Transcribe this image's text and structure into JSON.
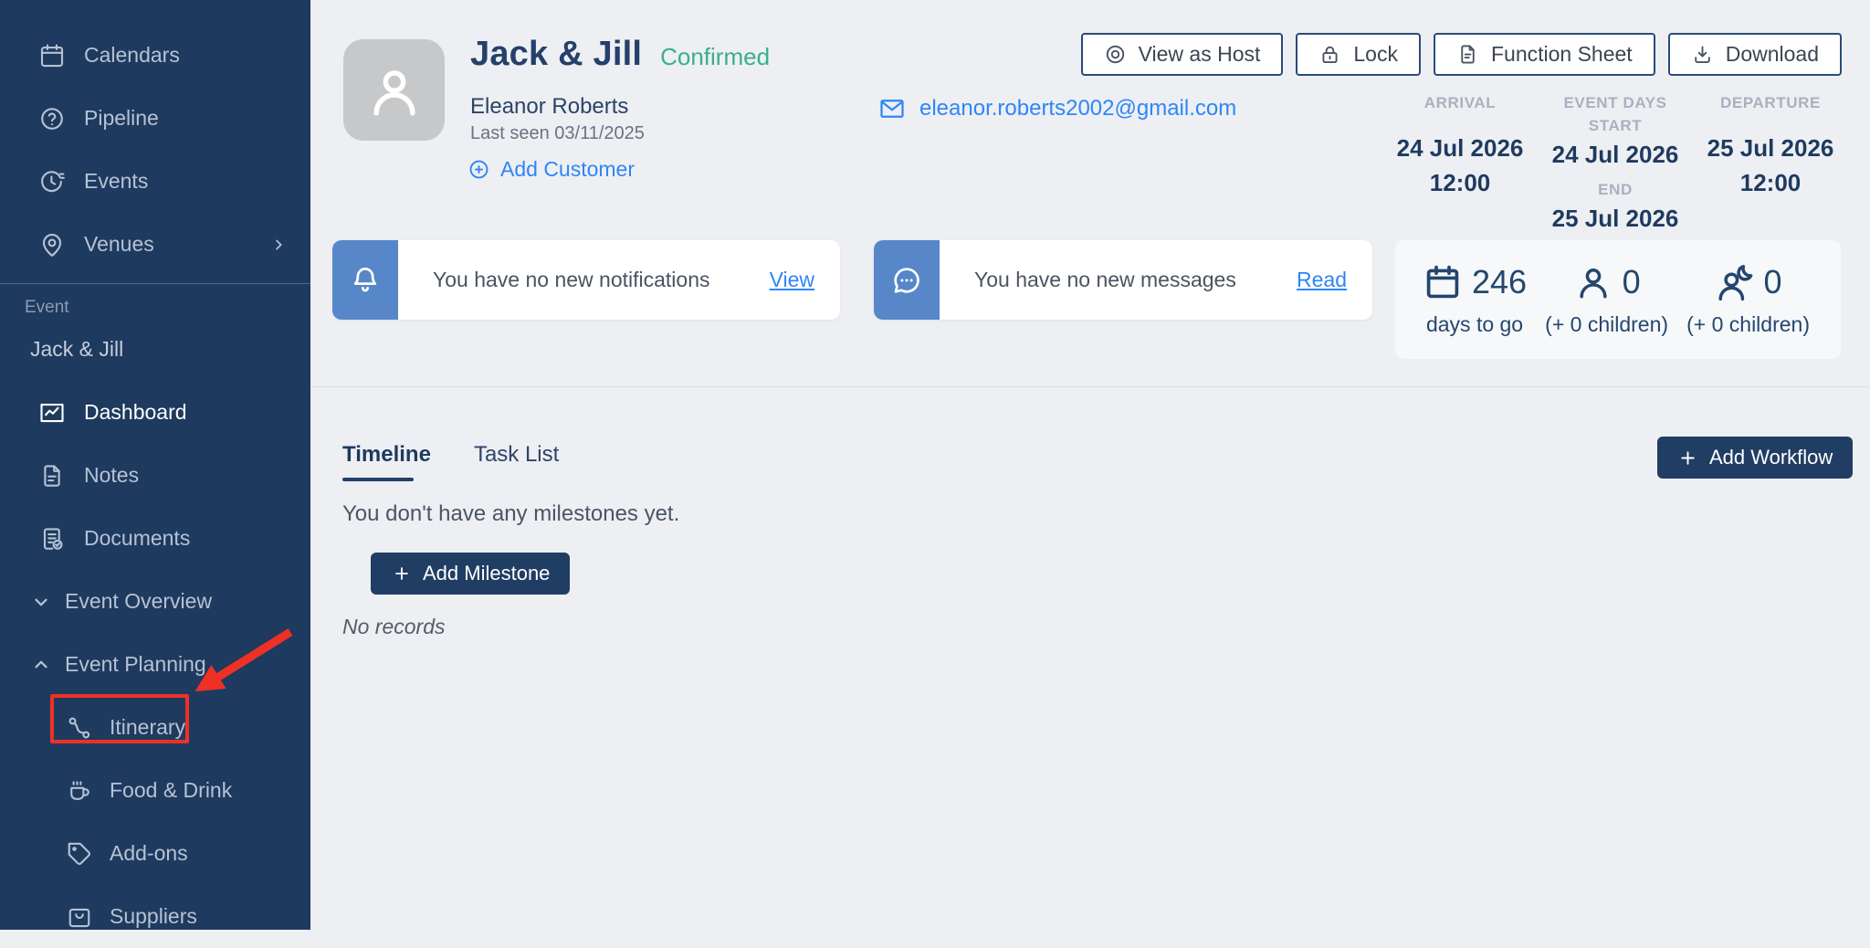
{
  "sidebar": {
    "section_label": "Event",
    "event_name": "Jack & Jill",
    "items": [
      {
        "label": "Calendars",
        "icon": "calendar-icon"
      },
      {
        "label": "Pipeline",
        "icon": "help-circle-icon"
      },
      {
        "label": "Events",
        "icon": "clock-icon"
      },
      {
        "label": "Venues",
        "icon": "map-pin-icon",
        "chevron": "right"
      },
      {
        "label": "Dashboard",
        "icon": "chart-icon",
        "active": true
      },
      {
        "label": "Notes",
        "icon": "note-icon"
      },
      {
        "label": "Documents",
        "icon": "document-check-icon"
      },
      {
        "label": "Event Overview",
        "icon": "chevron-down-icon",
        "expanded": false
      },
      {
        "label": "Event Planning",
        "icon": "chevron-up-icon",
        "expanded": true
      },
      {
        "label": "Itinerary",
        "icon": "route-icon",
        "annotated": true
      },
      {
        "label": "Food & Drink",
        "icon": "coffee-icon"
      },
      {
        "label": "Add-ons",
        "icon": "tag-icon"
      },
      {
        "label": "Suppliers",
        "icon": "case-icon"
      }
    ]
  },
  "header": {
    "title": "Jack & Jill",
    "status": "Confirmed",
    "customer_name": "Eleanor Roberts",
    "last_seen": "Last seen 03/11/2025",
    "add_customer_label": "Add Customer",
    "email": "eleanor.roberts2002@gmail.com",
    "actions": [
      {
        "label": "View as Host",
        "icon": "view-icon"
      },
      {
        "label": "Lock",
        "icon": "lock-icon"
      },
      {
        "label": "Function Sheet",
        "icon": "file-icon"
      },
      {
        "label": "Download",
        "icon": "download-icon"
      }
    ],
    "dates": {
      "arrival_label": "ARRIVAL",
      "arrival_date": "24 Jul 2026",
      "arrival_time": "12:00",
      "event_days_label": "EVENT DAYS",
      "start_label": "START",
      "start_date": "24 Jul 2026",
      "end_label": "END",
      "end_date": "25 Jul 2026",
      "departure_label": "DEPARTURE",
      "departure_date": "25 Jul 2026",
      "departure_time": "12:00"
    }
  },
  "cards": {
    "notifications": {
      "text": "You have no new notifications",
      "action": "View"
    },
    "messages": {
      "text": "You have no new messages",
      "action": "Read"
    },
    "stats": [
      {
        "value": "246",
        "label": "days to go",
        "icon": "calendar-icon"
      },
      {
        "value": "0",
        "label": "(+ 0 children)",
        "icon": "person-icon"
      },
      {
        "value": "0",
        "label": "(+ 0 children)",
        "icon": "person-moon-icon"
      }
    ]
  },
  "content": {
    "tabs": [
      {
        "label": "Timeline",
        "active": true
      },
      {
        "label": "Task List",
        "active": false
      }
    ],
    "add_workflow_label": "Add Workflow",
    "empty_message": "You don't have any milestones yet.",
    "add_milestone_label": "Add Milestone",
    "no_records": "No records"
  },
  "colors": {
    "sidebar_bg": "#1E3A5F",
    "page_bg": "#EDEFF3",
    "navy": "#24406B",
    "link_blue": "#2F86F6",
    "status_green": "#3AAF8C",
    "card_icon_blue": "#5787C9",
    "annotation_red": "#EE3124"
  }
}
